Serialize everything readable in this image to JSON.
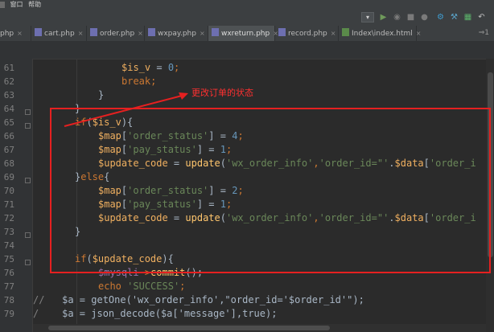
{
  "menu": {
    "items": [
      "窗口",
      "帮助"
    ]
  },
  "toolbar": {
    "dropdown_glyph": "▾"
  },
  "tabs": [
    {
      "label": "php",
      "close": "×"
    },
    {
      "label": "cart.php",
      "close": "×"
    },
    {
      "label": "order.php",
      "close": "×"
    },
    {
      "label": "wxpay.php",
      "close": "×"
    },
    {
      "label": "wxreturn.php",
      "close": "×",
      "active": true
    },
    {
      "label": "record.php",
      "close": "×"
    },
    {
      "label": "Index\\index.html",
      "close": "×"
    }
  ],
  "tab_overflow": "⇒1",
  "line_numbers": [
    "61",
    "62",
    "63",
    "64",
    "65",
    "66",
    "67",
    "68",
    "69",
    "70",
    "71",
    "72",
    "73",
    "74",
    "75",
    "76",
    "77",
    "78",
    "79"
  ],
  "annotation": {
    "text": "更改订单的状态",
    "color": "#e52020"
  },
  "colors": {
    "background": "#2b2b2b",
    "keyword": "#cc7832",
    "string": "#6a8759",
    "number": "#6897bb",
    "variable": "#f0b060"
  },
  "icons": [
    "dropdown-icon",
    "run-icon",
    "debug-icon",
    "stop-icon",
    "build-icon",
    "settings-icon",
    "tools-icon",
    "undo-icon"
  ],
  "code": {
    "l61": [
      "$is_v",
      " = ",
      "0",
      ";"
    ],
    "l62": [
      "break",
      ";"
    ],
    "l63": [
      "}"
    ],
    "l64": [
      "}"
    ],
    "l65": [
      "if",
      "(",
      "$is_v",
      "){"
    ],
    "l66": [
      "$map",
      "[",
      "'order_status'",
      "] = ",
      "4",
      ";"
    ],
    "l67": [
      "$map",
      "[",
      "'pay_status'",
      "] = ",
      "1",
      ";"
    ],
    "l68": [
      "$update_code",
      " = ",
      "update",
      "(",
      "'wx_order_info'",
      ",",
      "'order_id=\"'",
      ".",
      "$data",
      "[",
      "'order_i"
    ],
    "l69": [
      "}",
      "else",
      "{"
    ],
    "l70": [
      "$map",
      "[",
      "'order_status'",
      "] = ",
      "2",
      ";"
    ],
    "l71": [
      "$map",
      "[",
      "'pay_status'",
      "] = ",
      "1",
      ";"
    ],
    "l72": [
      "$update_code",
      " = ",
      "update",
      "(",
      "'wx_order_info'",
      ",",
      "'order_id=\"'",
      ".",
      "$data",
      "[",
      "'order_i"
    ],
    "l73": [
      "}"
    ],
    "l75": [
      "if",
      "(",
      "$update_code",
      "){"
    ],
    "l76": [
      "$mysqli",
      "->",
      "commit",
      "();"
    ],
    "l77": [
      "echo",
      " ",
      "'SUCCESS'",
      ";"
    ],
    "l78": [
      "//",
      "   $a = getOne('wx_order_info',\"order_id='$order_id'\");"
    ],
    "l79": [
      "/",
      "    $a = json_decode($a['message'],true);"
    ]
  }
}
